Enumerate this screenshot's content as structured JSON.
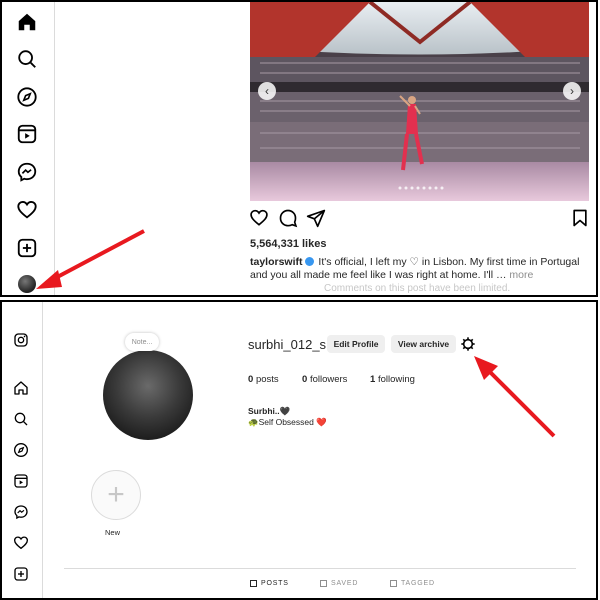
{
  "post": {
    "likes": "5,564,331 likes",
    "username": "taylorswift",
    "caption_line1": " It's official, I left my ",
    "caption_line1_end": " in Lisbon. My first time in Portugal",
    "caption_line2": "and you all made me feel like I was right at home. I'll … ",
    "more_label": "more",
    "comments_limited": "Comments on this post have been limited."
  },
  "profile": {
    "note_label": "Note...",
    "username": "surbhi_012_s",
    "edit_profile_label": "Edit Profile",
    "view_archive_label": "View archive",
    "posts_count": "0",
    "posts_label": "posts",
    "followers_count": "0",
    "followers_label": "followers",
    "following_count": "1",
    "following_label": "following",
    "bio_name": "Surbhi..🖤",
    "bio_text": "🐢Self Obsessed ❤️",
    "new_highlight_label": "New",
    "tabs": [
      {
        "label": "POSTS"
      },
      {
        "label": "SAVED"
      },
      {
        "label": "TAGGED"
      }
    ]
  },
  "icons": {
    "top_rail": [
      "home-icon",
      "search-icon",
      "explore-icon",
      "reels-icon",
      "messenger-icon",
      "heart-icon",
      "create-icon"
    ],
    "bottom_rail": [
      "instagram-logo-icon",
      "home-icon",
      "search-icon",
      "explore-icon",
      "reels-icon",
      "messenger-icon",
      "heart-icon",
      "create-icon"
    ]
  },
  "colors": {
    "annotation_arrow": "#e8191f",
    "verified_badge": "#3897f0",
    "border": "#dbdbdb"
  }
}
